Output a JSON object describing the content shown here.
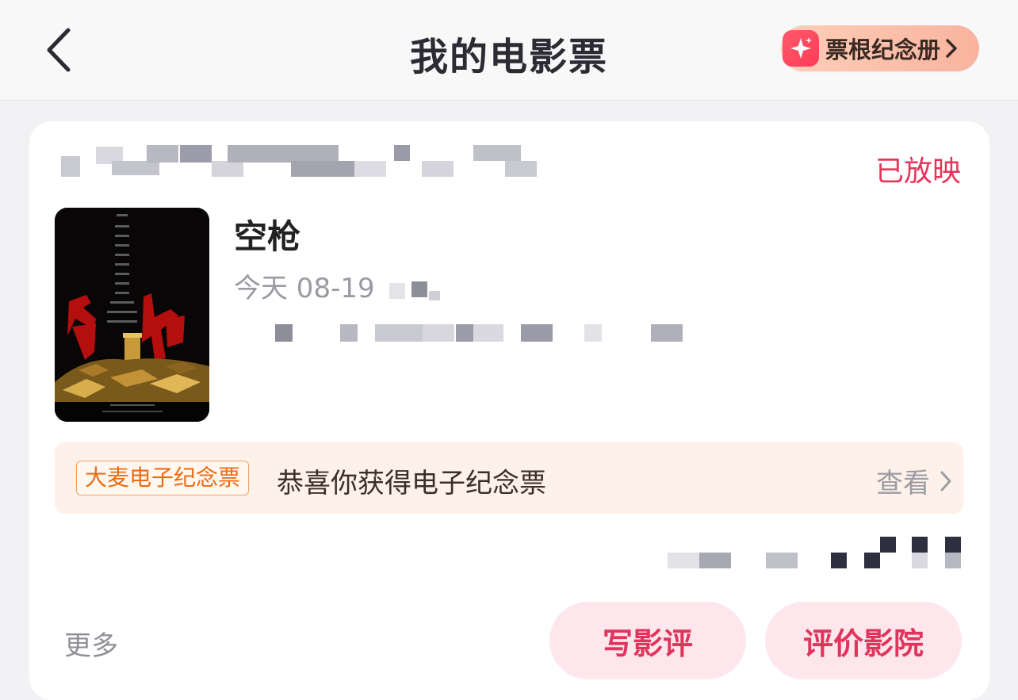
{
  "header": {
    "title": "我的电影票",
    "back_icon": "chevron-left-icon",
    "album_button": "票根纪念册",
    "album_icon": "sparkle-ticket-icon"
  },
  "ticket": {
    "status": "已放映",
    "movie_title": "空枪",
    "show_time": "今天 08-19",
    "poster": {
      "title_text": "空枪"
    }
  },
  "souvenir": {
    "badge": "大麦电子纪念票",
    "message": "恭喜你获得电子纪念票",
    "view_label": "查看"
  },
  "actions": {
    "more": "更多",
    "write_review": "写影评",
    "rate_cinema": "评价影院"
  },
  "colors": {
    "accent": "#e8345a",
    "badge_orange": "#ec6b12",
    "pill_bg": "#fde7ec"
  }
}
